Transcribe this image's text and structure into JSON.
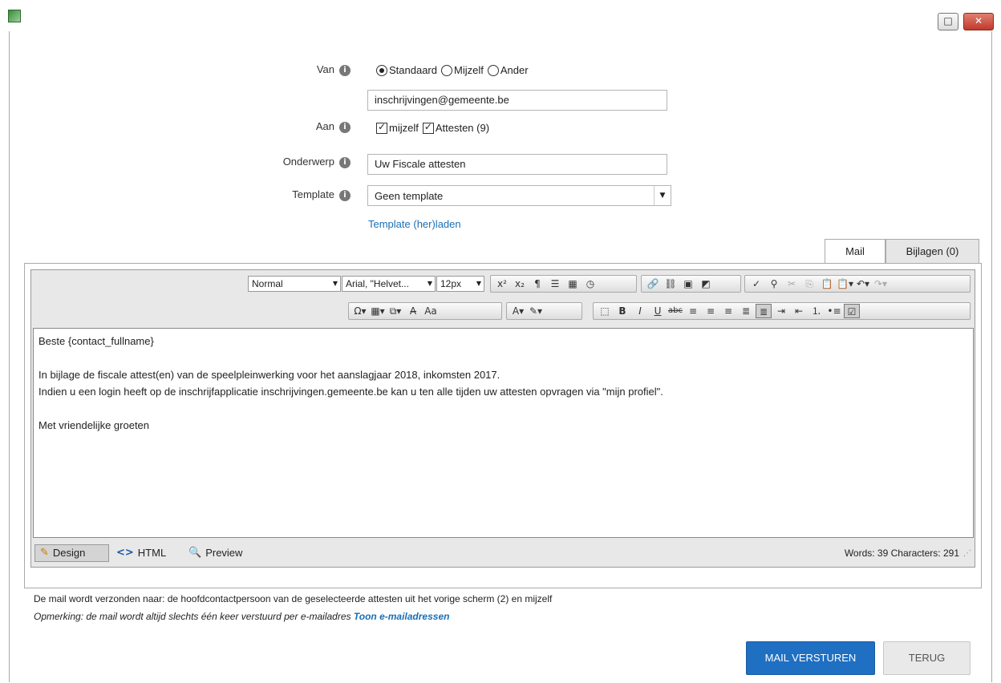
{
  "window": {
    "max_glyph": "□",
    "close_glyph": "✕"
  },
  "form": {
    "van_label": "Van",
    "van_options": [
      "Standaard",
      "Mijzelf",
      "Ander"
    ],
    "van_email": "inschrijvingen@gemeente.be",
    "aan_label": "Aan",
    "aan_options": [
      "mijzelf",
      "Attesten (9)"
    ],
    "onderwerp_label": "Onderwerp",
    "onderwerp_value": "Uw Fiscale attesten",
    "template_label": "Template",
    "template_value": "Geen template",
    "template_reload": "Template (her)laden",
    "info_glyph": "i"
  },
  "tabs": {
    "mail": "Mail",
    "bijlagen": "Bijlagen (0)"
  },
  "editor": {
    "format": "Normal",
    "font": "Arial, \"Helvet...",
    "size": "12px",
    "content": {
      "line1": "Beste {contact_fullname}",
      "line2": "In bijlage de fiscale attest(en) van de speelpleinwerking voor het aanslagjaar 2018, inkomsten 2017.",
      "line3": "Indien u een login heeft op de inschrijfapplicatie inschrijvingen.gemeente.be kan u ten alle tijden uw attesten opvragen via \"mijn profiel\".",
      "line4": "Met vriendelijke groeten"
    },
    "modes": {
      "design": "Design",
      "html": "HTML",
      "preview": "Preview"
    },
    "stats": "Words: 39   Characters: 291"
  },
  "footer": {
    "note1": "De mail wordt verzonden naar: de hoofdcontactpersoon van de geselecteerde attesten uit het vorige scherm (2) en mijzelf",
    "note2": "Opmerking: de mail wordt altijd slechts één keer verstuurd per e-mailadres",
    "note2_link": "Toon e-mailadressen",
    "send": "MAIL VERSTUREN",
    "back": "TERUG"
  }
}
